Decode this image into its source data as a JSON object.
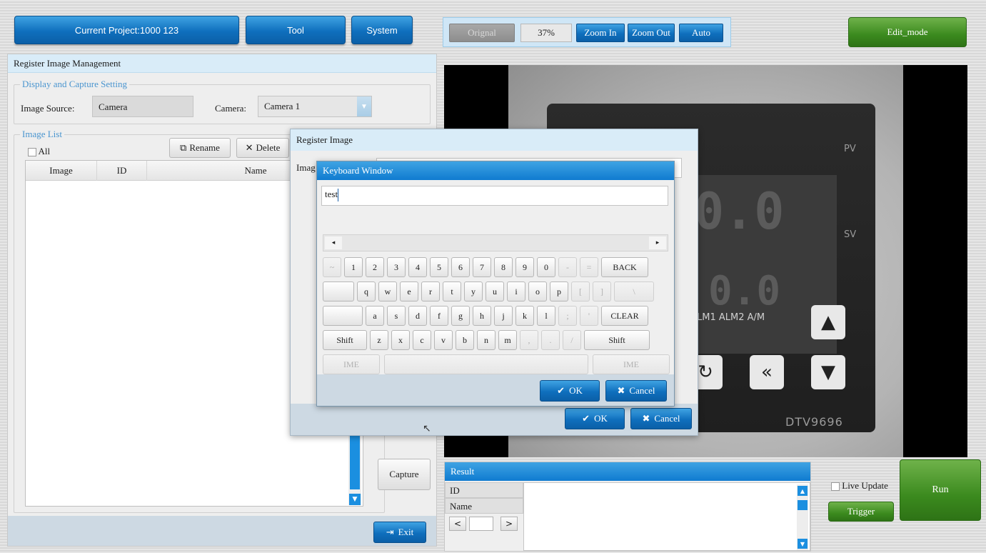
{
  "topbar": {
    "project_label": "Current Project:1000   123",
    "tool_label": "Tool",
    "system_label": "System",
    "edit_mode_label": "Edit_mode"
  },
  "zoom": {
    "original_label": "Orignal",
    "level": "37%",
    "zoom_in_label": "Zoom In",
    "zoom_out_label": "Zoom Out",
    "auto_label": "Auto"
  },
  "register_panel": {
    "title": "Register Image Management",
    "display_group": "Display and Capture Setting",
    "image_source_label": "Image Source:",
    "image_source_value": "Camera",
    "camera_label": "Camera:",
    "camera_value": "Camera 1",
    "image_list_group": "Image List",
    "all_label": "All",
    "rename_label": "Rename",
    "delete_label": "Delete",
    "columns": [
      "Image",
      "ID",
      "Name"
    ],
    "capture_label": "Capture",
    "exit_label": "Exit"
  },
  "register_dialog": {
    "title": "Register Image",
    "image_label_partial": "Imag",
    "ok_label": "OK",
    "cancel_label": "Cancel"
  },
  "keyboard": {
    "title": "Keyboard Window",
    "input_value": "test",
    "row1": [
      "~",
      "1",
      "2",
      "3",
      "4",
      "5",
      "6",
      "7",
      "8",
      "9",
      "0",
      "-",
      "=",
      "BACK"
    ],
    "row2": [
      "q",
      "w",
      "e",
      "r",
      "t",
      "y",
      "u",
      "i",
      "o",
      "p",
      "[",
      "]",
      "\\"
    ],
    "row3": [
      "a",
      "s",
      "d",
      "f",
      "g",
      "h",
      "j",
      "k",
      "l",
      ";",
      "'",
      "CLEAR"
    ],
    "row4": [
      "Shift",
      "z",
      "x",
      "c",
      "v",
      "b",
      "n",
      "m",
      ",",
      ".",
      "/",
      "Shift"
    ],
    "ime_left": "IME",
    "ime_right": "IME",
    "ok_label": "OK",
    "cancel_label": "Cancel"
  },
  "camera_view": {
    "pv_label": "PV",
    "sv_label": "SV",
    "alarm_labels": "LM1  ALM2  A/M",
    "model_label": "DTV9696",
    "digits_top": "0.0",
    "digits_bottom": "0.0"
  },
  "result": {
    "title": "Result",
    "rows": [
      "ID",
      "Name"
    ],
    "prev_label": "<",
    "next_label": ">",
    "page_value": ""
  },
  "run_controls": {
    "live_update_label": "Live Update",
    "trigger_label": "Trigger",
    "run_label": "Run"
  },
  "colors": {
    "accent_blue": "#0f6fbd",
    "accent_green": "#3b8a1e",
    "title_light_blue": "#d9ecf8"
  }
}
